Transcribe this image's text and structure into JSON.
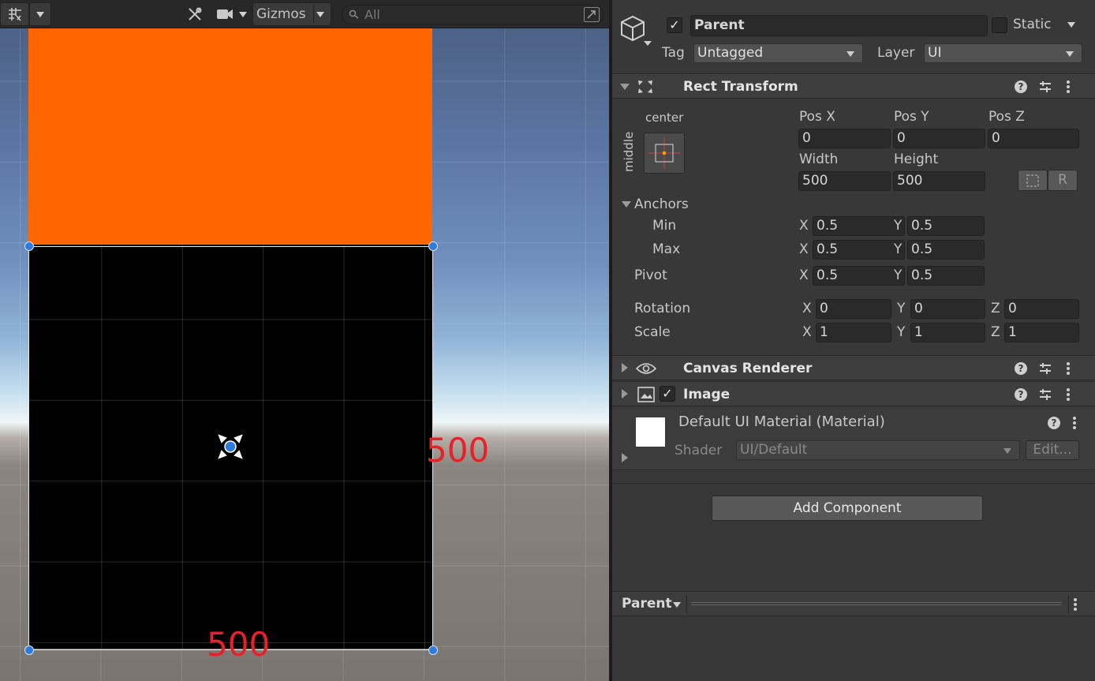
{
  "scene": {
    "toolbar": {
      "gizmos_label": "Gizmos",
      "search_placeholder": "All"
    },
    "labels": {
      "height_annotation": "500",
      "width_annotation": "500"
    },
    "colors": {
      "orange_rect": "#ff6600",
      "black_rect": "#000000",
      "annotation": "#e8202a",
      "handle": "#2f7bdc"
    }
  },
  "inspector": {
    "object": {
      "name": "Parent",
      "active": true,
      "static_label": "Static",
      "tag_label": "Tag",
      "tag_value": "Untagged",
      "layer_label": "Layer",
      "layer_value": "UI"
    },
    "rect_transform": {
      "title": "Rect Transform",
      "anchor_preset_h": "center",
      "anchor_preset_v": "middle",
      "pos_x_label": "Pos X",
      "pos_y_label": "Pos Y",
      "pos_z_label": "Pos Z",
      "pos_x": "0",
      "pos_y": "0",
      "pos_z": "0",
      "width_label": "Width",
      "height_label": "Height",
      "width": "500",
      "height": "500",
      "raw_edit_label": "R",
      "anchors_label": "Anchors",
      "min_label": "Min",
      "max_label": "Max",
      "anchor_min_x": "0.5",
      "anchor_min_y": "0.5",
      "anchor_max_x": "0.5",
      "anchor_max_y": "0.5",
      "pivot_label": "Pivot",
      "pivot_x": "0.5",
      "pivot_y": "0.5",
      "rotation_label": "Rotation",
      "rotation_x": "0",
      "rotation_y": "0",
      "rotation_z": "0",
      "scale_label": "Scale",
      "scale_x": "1",
      "scale_y": "1",
      "scale_z": "1",
      "axis_x": "X",
      "axis_y": "Y",
      "axis_z": "Z"
    },
    "canvas_renderer": {
      "title": "Canvas Renderer"
    },
    "image": {
      "title": "Image",
      "enabled": true
    },
    "material": {
      "name": "Default UI Material (Material)",
      "shader_label": "Shader",
      "shader_value": "UI/Default",
      "edit_label": "Edit..."
    },
    "add_component_label": "Add Component",
    "preview": {
      "title": "Parent"
    }
  }
}
